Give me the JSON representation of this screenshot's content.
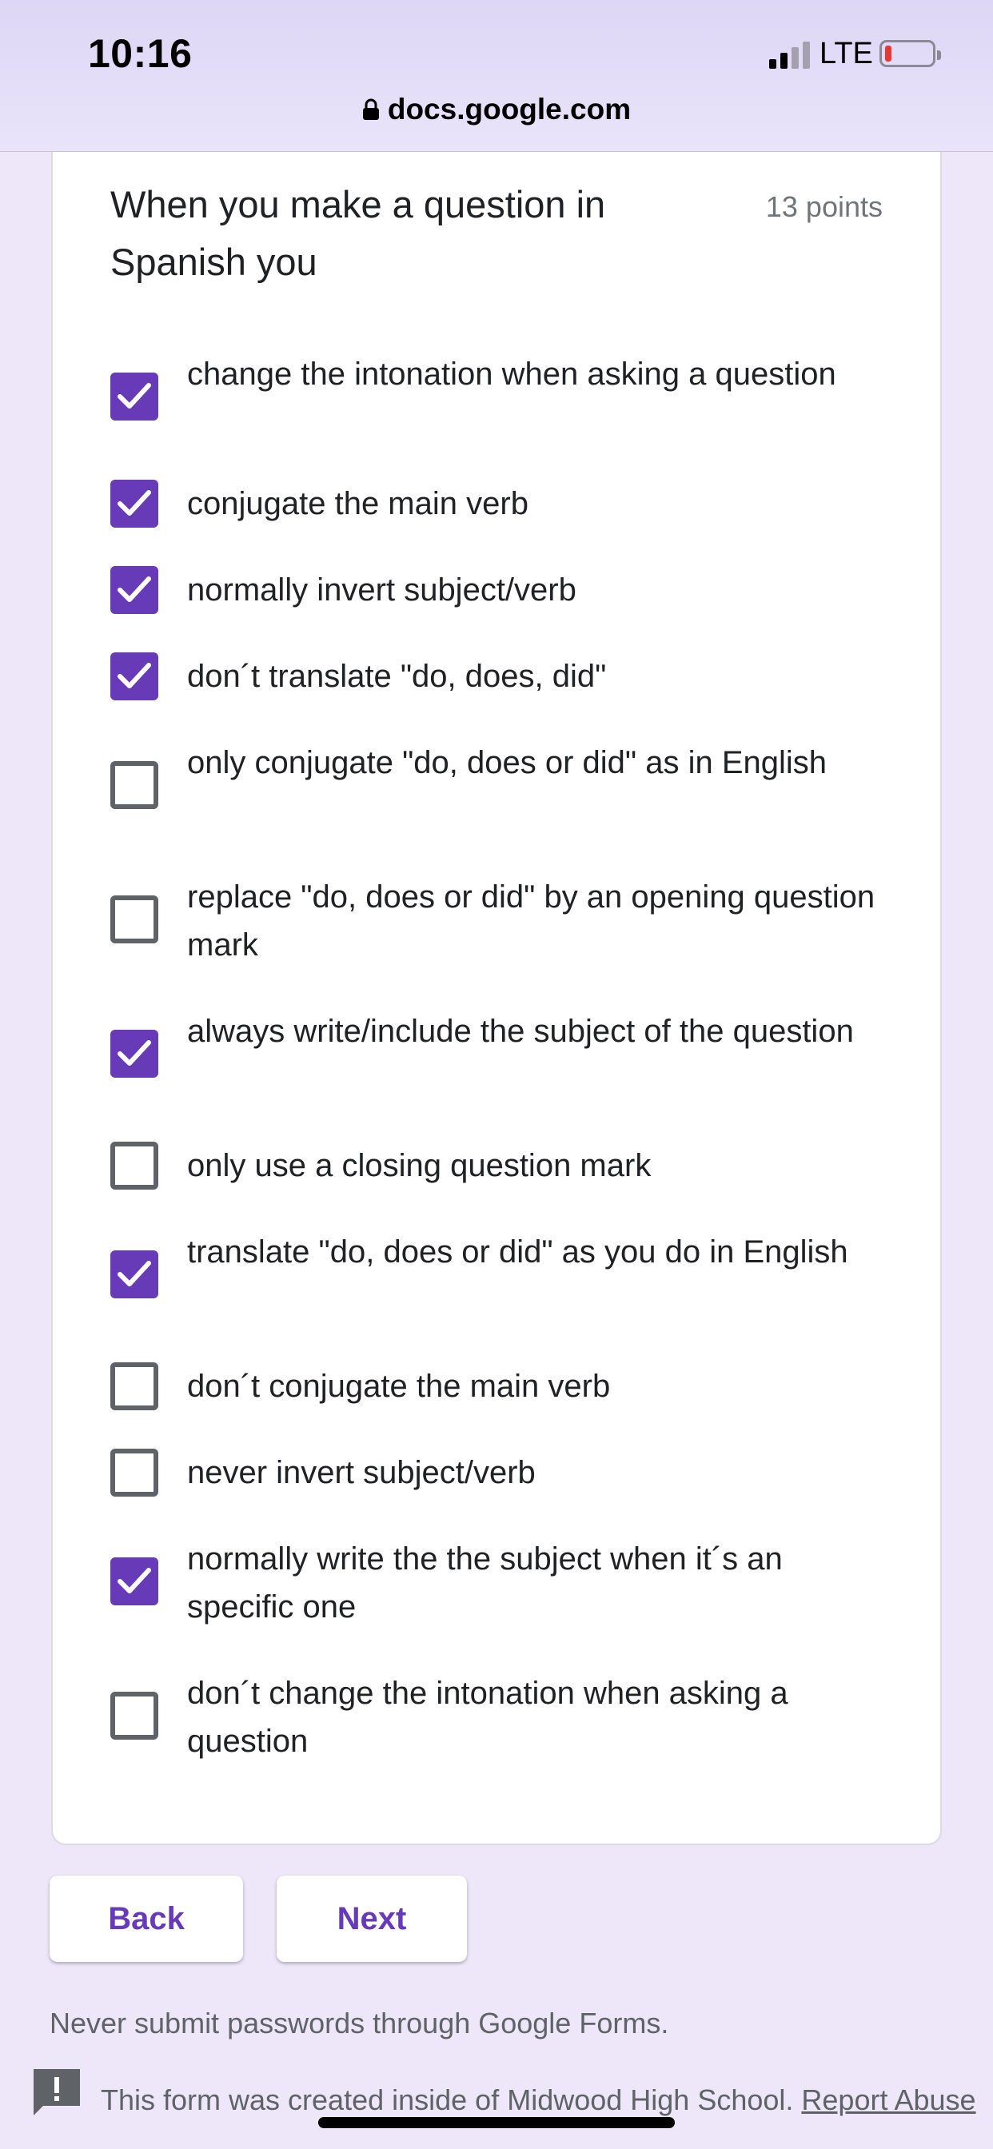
{
  "status_bar": {
    "time": "10:16",
    "network": "LTE",
    "url": "docs.google.com"
  },
  "question": {
    "title": "When you make a question in Spanish you",
    "points": "13 points",
    "options": [
      {
        "label": "change the intonation when asking a question",
        "checked": true
      },
      {
        "label": "conjugate the main verb",
        "checked": true
      },
      {
        "label": "normally invert subject/verb",
        "checked": true
      },
      {
        "label": "don´t translate \"do, does, did\"",
        "checked": true
      },
      {
        "label": "only conjugate \"do, does or did\" as in English",
        "checked": false
      },
      {
        "label": "replace \"do, does or did\" by an opening question mark",
        "checked": false
      },
      {
        "label": "always write/include the subject of the question",
        "checked": true
      },
      {
        "label": "only use a closing question mark",
        "checked": false
      },
      {
        "label": "translate \"do, does or did\" as you do in English",
        "checked": true
      },
      {
        "label": "don´t conjugate the main verb",
        "checked": false
      },
      {
        "label": "never invert subject/verb",
        "checked": false
      },
      {
        "label": "normally write the the subject when it´s an specific one",
        "checked": true
      },
      {
        "label": "don´t change the intonation when asking a question",
        "checked": false
      }
    ]
  },
  "nav": {
    "back_label": "Back",
    "next_label": "Next"
  },
  "footer": {
    "password_warning": "Never submit passwords through Google Forms.",
    "created_text": "This form was created inside of Midwood High School.",
    "report_link": "Report Abuse"
  },
  "colors": {
    "accent": "#673ab7",
    "page_background": "#ede7f9"
  }
}
